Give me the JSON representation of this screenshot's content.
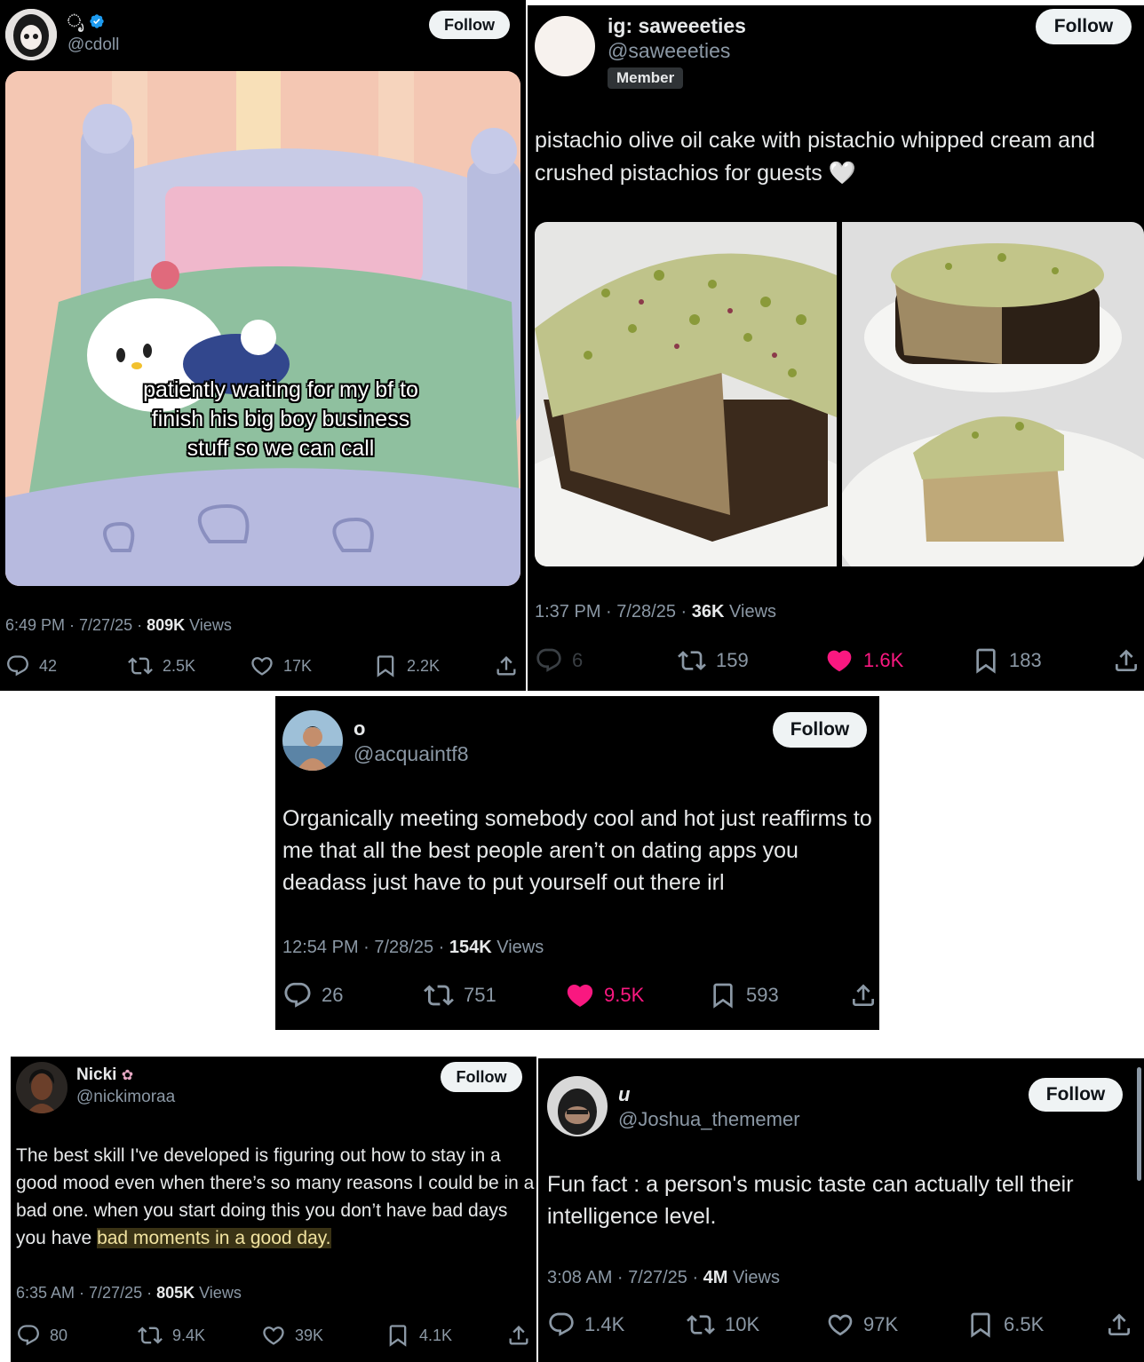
{
  "follow_label": "Follow",
  "colors": {
    "like_pink": "#f91880",
    "verified_blue": "#1d9bf0",
    "text_gray": "#8b98a5"
  },
  "posts": [
    {
      "name": "ೃ",
      "verified": true,
      "handle": "@cdoll",
      "image_caption": "patiently waiting for my bf to finish his big boy business stuff so we can call",
      "time": "6:49 PM · 7/27/25 · ",
      "views": "809K",
      "views_label": " Views",
      "replies": "42",
      "reposts": "2.5K",
      "likes": "17K",
      "bookmarks": "2.2K"
    },
    {
      "name": "ig: saweeeties",
      "handle": "@saweeeties",
      "badge": "Member",
      "text": "pistachio olive oil cake with pistachio whipped cream and crushed pistachios for guests 🤍",
      "time": "1:37 PM · 7/28/25 · ",
      "views": "36K",
      "views_label": " Views",
      "replies": "6",
      "reposts": "159",
      "likes": "1.6K",
      "bookmarks": "183"
    },
    {
      "name": "o",
      "handle": "@acquaintf8",
      "text": "Organically meeting somebody cool and hot just reaffirms to me that all the best people aren’t on dating apps you deadass just have to put yourself out there irl",
      "time": "12:54 PM · 7/28/25 · ",
      "views": "154K",
      "views_label": " Views",
      "replies": "26",
      "reposts": "751",
      "likes": "9.5K",
      "bookmarks": "593"
    },
    {
      "name": "Nicki",
      "handle": "@nickimoraa",
      "text_plain": "The best skill I've developed is figuring out how to stay in a good mood even when there’s so many reasons I could be in a bad one. when you start doing this you don’t have bad days you have ",
      "text_highlight": "bad moments in a good day.",
      "time": "6:35 AM · 7/27/25 · ",
      "views": "805K",
      "views_label": " Views",
      "replies": "80",
      "reposts": "9.4K",
      "likes": "39K",
      "bookmarks": "4.1K"
    },
    {
      "name": "и",
      "handle": "@Joshua_thememer",
      "text": "Fun fact : a person's music taste can actually tell their intelligence level.",
      "time": "3:08 AM · 7/27/25 · ",
      "views": "4M",
      "views_label": " Views",
      "replies": "1.4K",
      "reposts": "10K",
      "likes": "97K",
      "bookmarks": "6.5K"
    }
  ]
}
